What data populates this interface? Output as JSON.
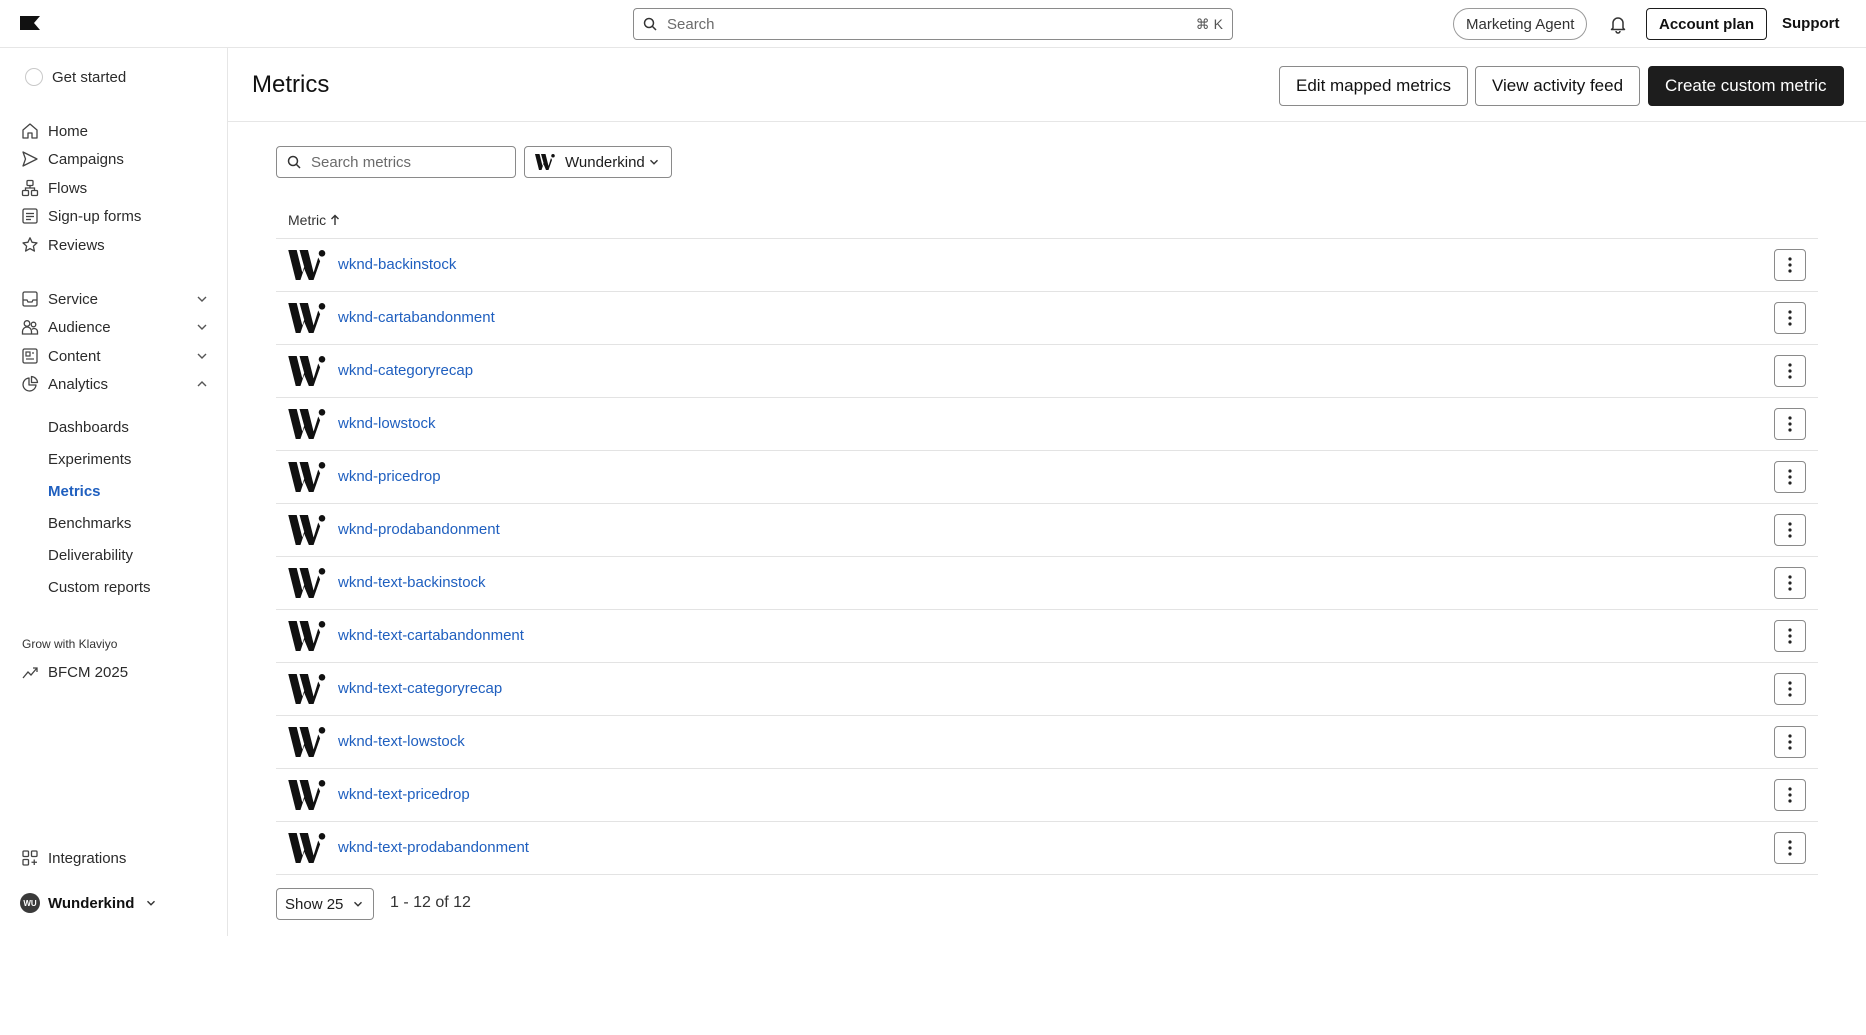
{
  "topbar": {
    "search_placeholder": "Search",
    "search_shortcut": "⌘ K",
    "marketing_agent_label": "Marketing Agent",
    "account_plan_label": "Account plan",
    "support_label": "Support"
  },
  "sidebar": {
    "get_started": "Get started",
    "main_items": [
      {
        "label": "Home",
        "icon": "home-icon"
      },
      {
        "label": "Campaigns",
        "icon": "send-icon"
      },
      {
        "label": "Flows",
        "icon": "flows-icon"
      },
      {
        "label": "Sign-up forms",
        "icon": "form-icon"
      },
      {
        "label": "Reviews",
        "icon": "star-icon"
      }
    ],
    "group_items": [
      {
        "label": "Service",
        "icon": "inbox-icon",
        "expanded": false
      },
      {
        "label": "Audience",
        "icon": "people-icon",
        "expanded": false
      },
      {
        "label": "Content",
        "icon": "content-icon",
        "expanded": false
      },
      {
        "label": "Analytics",
        "icon": "pie-chart-icon",
        "expanded": true
      }
    ],
    "analytics_sub": [
      "Dashboards",
      "Experiments",
      "Metrics",
      "Benchmarks",
      "Deliverability",
      "Custom reports"
    ],
    "active_sub": "Metrics",
    "grow_label": "Grow with Klaviyo",
    "bfcm_label": "BFCM 2025",
    "integrations_label": "Integrations",
    "account_initials": "WU",
    "account_name": "Wunderkind"
  },
  "header": {
    "title": "Metrics",
    "edit_mapped_label": "Edit mapped metrics",
    "activity_feed_label": "View activity feed",
    "create_custom_label": "Create custom metric"
  },
  "filters": {
    "search_placeholder": "Search metrics",
    "brand_filter_label": "Wunderkind"
  },
  "table": {
    "column_header": "Metric",
    "sort": "ascending",
    "rows": [
      "wknd-backinstock",
      "wknd-cartabandonment",
      "wknd-categoryrecap",
      "wknd-lowstock",
      "wknd-pricedrop",
      "wknd-prodabandonment",
      "wknd-text-backinstock",
      "wknd-text-cartabandonment",
      "wknd-text-categoryrecap",
      "wknd-text-lowstock",
      "wknd-text-pricedrop",
      "wknd-text-prodabandonment"
    ]
  },
  "pagination": {
    "show_label": "Show 25",
    "range_label": "1 - 12 of 12"
  },
  "colors": {
    "link": "#1f5fbf",
    "primary_button": "#1d1d1d",
    "border": "#e3e3e3"
  }
}
